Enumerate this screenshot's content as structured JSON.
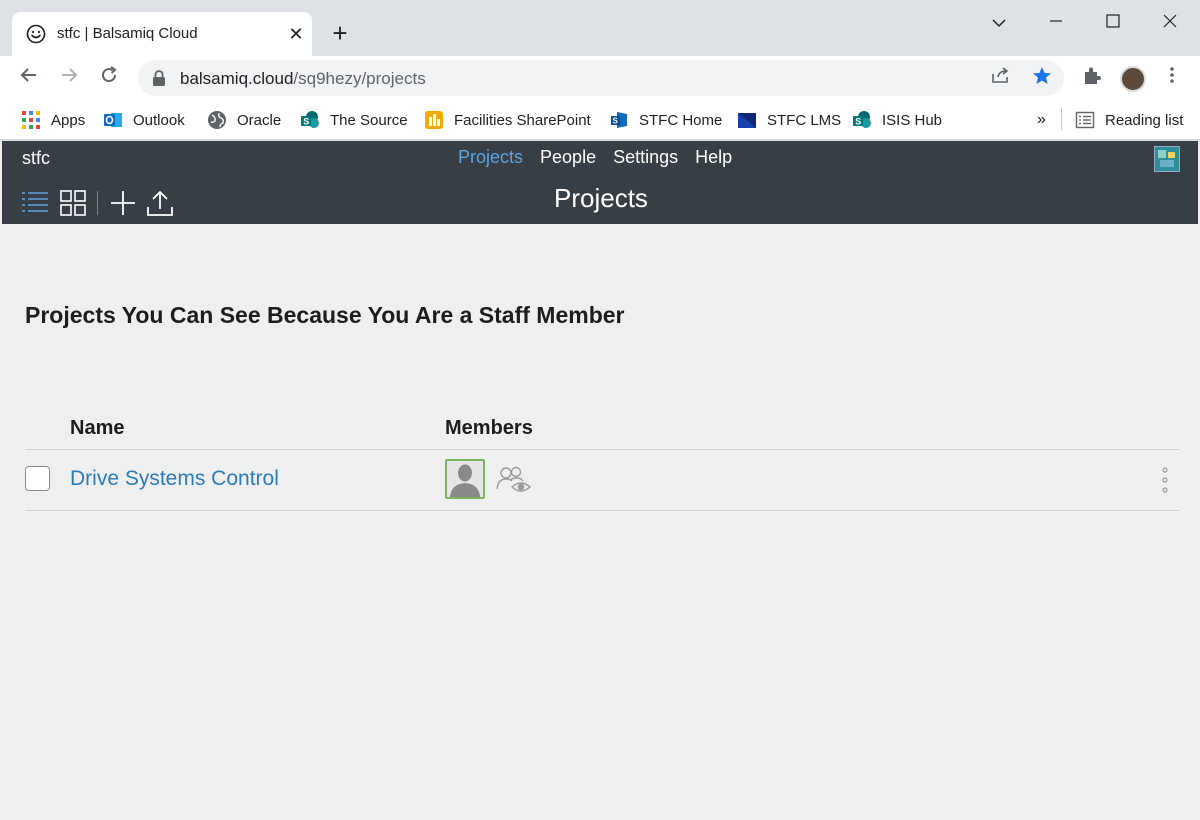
{
  "browser": {
    "tab": {
      "title": "stfc | Balsamiq Cloud",
      "close": "✕"
    },
    "new_tab": "+",
    "url": {
      "host": "balsamiq.cloud",
      "path": "/sq9hezy/projects"
    },
    "bookmarks": [
      {
        "label": "Apps",
        "icon": "apps-grid-icon",
        "color": "#ea4335"
      },
      {
        "label": "Outlook",
        "icon": "outlook-icon",
        "color": "#0f6cbd"
      },
      {
        "label": "Oracle",
        "icon": "globe-icon",
        "color": "#5f6368"
      },
      {
        "label": "The Source",
        "icon": "sharepoint-icon",
        "color": "#03787c"
      },
      {
        "label": "Facilities SharePoint",
        "icon": "facilities-icon",
        "color": "#f2a900"
      },
      {
        "label": "STFC Home",
        "icon": "sharepoint-icon",
        "color": "#0f6cbd"
      },
      {
        "label": "STFC LMS",
        "icon": "lms-icon",
        "color": "#1a3fb0"
      },
      {
        "label": "ISIS Hub",
        "icon": "sharepoint-icon",
        "color": "#03787c"
      }
    ],
    "overflow": "»",
    "reading_list": "Reading list"
  },
  "app": {
    "brand": "stfc",
    "nav": [
      "Projects",
      "People",
      "Settings",
      "Help"
    ],
    "active_nav": "Projects",
    "title": "Projects",
    "accent_color": "#5ea3e0",
    "bar_color": "#373e45"
  },
  "content": {
    "section_title": "Projects You Can See Because You Are a Staff Member",
    "columns": {
      "name": "Name",
      "members": "Members"
    },
    "projects": [
      {
        "name": "Drive Systems Control"
      }
    ],
    "link_color": "#2c7bb6"
  }
}
